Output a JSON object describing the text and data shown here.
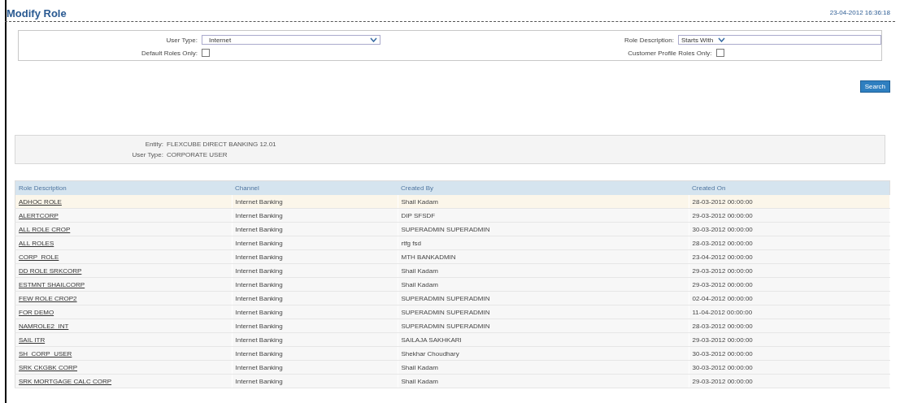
{
  "header": {
    "title": "Modify Role",
    "timestamp": "23-04-2012 16:36:18"
  },
  "filters": {
    "user_type": {
      "label": "User Type:",
      "value": "Internet"
    },
    "role_description": {
      "label": "Role Description:",
      "operator": "Starts With"
    },
    "default_roles_only": {
      "label": "Default Roles Only:",
      "checked": false
    },
    "customer_profile_roles_only": {
      "label": "Customer Profile Roles Only:",
      "checked": false
    },
    "search_button": "Search"
  },
  "info": [
    {
      "label": "Entity:",
      "value": "FLEXCUBE DIRECT BANKING 12.01"
    },
    {
      "label": "User Type:",
      "value": "CORPORATE USER"
    }
  ],
  "table": {
    "columns": [
      "Role Description",
      "Channel",
      "Created By",
      "Created On"
    ],
    "rows": [
      [
        "ADHOC ROLE",
        "Internet Banking",
        "Shail Kadam",
        "28-03-2012 00:00:00"
      ],
      [
        "ALERTCORP",
        "Internet Banking",
        "DIP SFSDF",
        "29-03-2012 00:00:00"
      ],
      [
        "ALL ROLE CROP",
        "Internet Banking",
        "SUPERADMIN SUPERADMIN",
        "30-03-2012 00:00:00"
      ],
      [
        "ALL ROLES",
        "Internet Banking",
        "rtfg fsd",
        "28-03-2012 00:00:00"
      ],
      [
        "CORP_ROLE",
        "Internet Banking",
        "MTH BANKADMIN",
        "23-04-2012 00:00:00"
      ],
      [
        "DD ROLE SRKCORP",
        "Internet Banking",
        "Shail Kadam",
        "29-03-2012 00:00:00"
      ],
      [
        "ESTMNT SHAILCORP",
        "Internet Banking",
        "Shail Kadam",
        "29-03-2012 00:00:00"
      ],
      [
        "FEW ROLE CROP2",
        "Internet Banking",
        "SUPERADMIN SUPERADMIN",
        "02-04-2012 00:00:00"
      ],
      [
        "FOR DEMO",
        "Internet Banking",
        "SUPERADMIN SUPERADMIN",
        "11-04-2012 00:00:00"
      ],
      [
        "NAMROLE2_INT",
        "Internet Banking",
        "SUPERADMIN SUPERADMIN",
        "28-03-2012 00:00:00"
      ],
      [
        "SAIL ITR",
        "Internet Banking",
        "SAILAJA SAKHKARI",
        "29-03-2012 00:00:00"
      ],
      [
        "SH_CORP_USER",
        "Internet Banking",
        "Shekhar Choudhary",
        "30-03-2012 00:00:00"
      ],
      [
        "SRK CKGBK CORP",
        "Internet Banking",
        "Shail Kadam",
        "30-03-2012 00:00:00"
      ],
      [
        "SRK MORTGAGE CALC CORP",
        "Internet Banking",
        "Shail Kadam",
        "29-03-2012 00:00:00"
      ]
    ]
  }
}
